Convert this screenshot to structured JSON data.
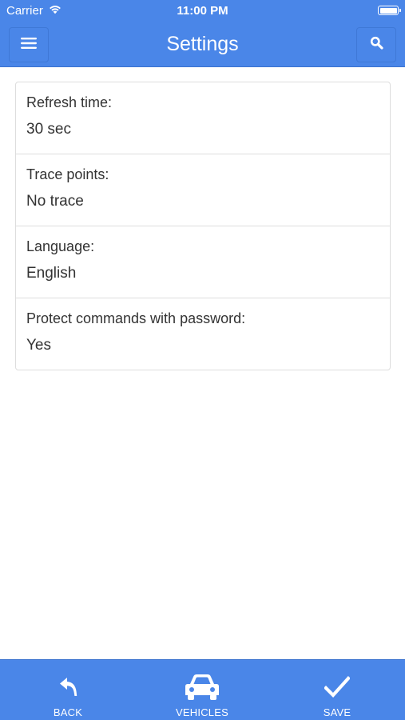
{
  "status_bar": {
    "carrier": "Carrier",
    "time": "11:00 PM"
  },
  "header": {
    "title": "Settings",
    "menu_icon": "hamburger-menu-icon",
    "search_icon": "search-icon"
  },
  "settings": [
    {
      "label": "Refresh time:",
      "value": "30 sec"
    },
    {
      "label": "Trace points:",
      "value": "No trace"
    },
    {
      "label": "Language:",
      "value": "English"
    },
    {
      "label": "Protect commands with password:",
      "value": "Yes"
    }
  ],
  "tab_bar": {
    "back": {
      "label": "BACK",
      "icon": "back-arrow-icon"
    },
    "vehicles": {
      "label": "VEHICLES",
      "icon": "car-icon"
    },
    "save": {
      "label": "SAVE",
      "icon": "checkmark-icon"
    }
  },
  "colors": {
    "primary": "#4a86e8",
    "text": "#333333",
    "border": "#dddddd"
  }
}
